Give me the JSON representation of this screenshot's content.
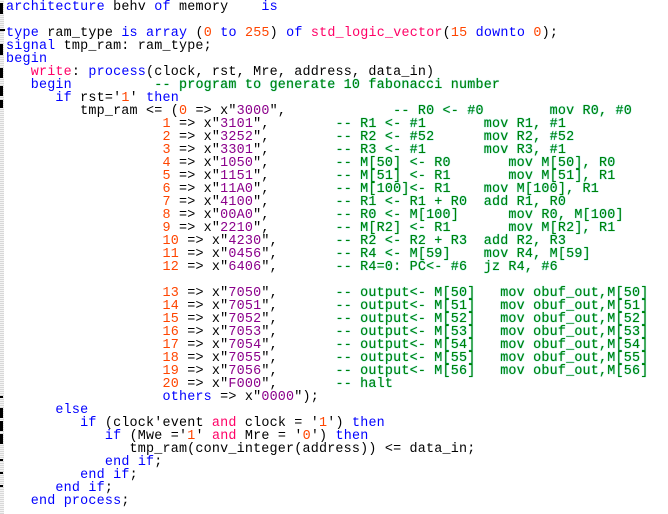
{
  "colors": {
    "keyword": "#0000ff",
    "type_function": "#ff0066",
    "number": "#ff4500",
    "string": "#8b008b",
    "comment": "#008000",
    "plain": "#000000"
  },
  "lines": [
    [
      [
        "kw",
        "architecture"
      ],
      [
        "id",
        " behv "
      ],
      [
        "kw",
        "of"
      ],
      [
        "id",
        " memory    "
      ],
      [
        "kw",
        "is"
      ]
    ],
    [],
    [
      [
        "kw",
        "type"
      ],
      [
        "id",
        " ram_type "
      ],
      [
        "kw",
        "is"
      ],
      [
        "id",
        " "
      ],
      [
        "kw",
        "array"
      ],
      [
        "id",
        " ("
      ],
      [
        "num",
        "0"
      ],
      [
        "id",
        " "
      ],
      [
        "kw",
        "to"
      ],
      [
        "id",
        " "
      ],
      [
        "num",
        "255"
      ],
      [
        "id",
        ") "
      ],
      [
        "kw",
        "of"
      ],
      [
        "id",
        " "
      ],
      [
        "fn",
        "std_logic_vector"
      ],
      [
        "id",
        "("
      ],
      [
        "num",
        "15"
      ],
      [
        "id",
        " "
      ],
      [
        "kw",
        "downto"
      ],
      [
        "id",
        " "
      ],
      [
        "num",
        "0"
      ],
      [
        "id",
        ");"
      ]
    ],
    [
      [
        "kw",
        "signal"
      ],
      [
        "id",
        " tmp_ram: ram_type;"
      ]
    ],
    [
      [
        "kw",
        "begin"
      ]
    ],
    [
      [
        "id",
        "   "
      ],
      [
        "fn",
        "write"
      ],
      [
        "id",
        ": "
      ],
      [
        "kw",
        "process"
      ],
      [
        "id",
        "(clock, rst, Mre, address, data_in)"
      ]
    ],
    [
      [
        "id",
        "   "
      ],
      [
        "kw",
        "begin"
      ],
      [
        "cm",
        "          -- program to generate 10 fabonacci number"
      ]
    ],
    [
      [
        "id",
        "      "
      ],
      [
        "kw",
        "if"
      ],
      [
        "id",
        " rst='"
      ],
      [
        "num",
        "1"
      ],
      [
        "id",
        "' "
      ],
      [
        "kw",
        "then"
      ]
    ],
    [
      [
        "id",
        "         tmp_ram <= ("
      ],
      [
        "num",
        "0"
      ],
      [
        "id",
        " => x\""
      ],
      [
        "str",
        "3000"
      ],
      [
        "id",
        "\","
      ],
      [
        "cm",
        "             -- R0 <- #0        mov R0, #0"
      ]
    ],
    [
      [
        "id",
        "                   "
      ],
      [
        "num",
        "1"
      ],
      [
        "id",
        " => x\""
      ],
      [
        "str",
        "3101"
      ],
      [
        "id",
        "\","
      ],
      [
        "cm",
        "        -- R1 <- #1       mov R1, #1"
      ]
    ],
    [
      [
        "id",
        "                   "
      ],
      [
        "num",
        "2"
      ],
      [
        "id",
        " => x\""
      ],
      [
        "str",
        "3252"
      ],
      [
        "id",
        "\","
      ],
      [
        "cm",
        "        -- R2 <- #52      mov R2, #52"
      ]
    ],
    [
      [
        "id",
        "                   "
      ],
      [
        "num",
        "3"
      ],
      [
        "id",
        " => x\""
      ],
      [
        "str",
        "3301"
      ],
      [
        "id",
        "\","
      ],
      [
        "cm",
        "        -- R3 <- #1       mov R3, #1"
      ]
    ],
    [
      [
        "id",
        "                   "
      ],
      [
        "num",
        "4"
      ],
      [
        "id",
        " => x\""
      ],
      [
        "str",
        "1050"
      ],
      [
        "id",
        "\","
      ],
      [
        "cm",
        "        -- M[50] <- R0       mov M[50], R0"
      ]
    ],
    [
      [
        "id",
        "                   "
      ],
      [
        "num",
        "5"
      ],
      [
        "id",
        " => x\""
      ],
      [
        "str",
        "1151"
      ],
      [
        "id",
        "\","
      ],
      [
        "cm",
        "        -- M[51] <- R1       mov M[51], R1"
      ]
    ],
    [
      [
        "id",
        "                   "
      ],
      [
        "num",
        "6"
      ],
      [
        "id",
        " => x\""
      ],
      [
        "str",
        "11A0"
      ],
      [
        "id",
        "\","
      ],
      [
        "cm",
        "        -- M[100]<- R1    mov M[100], R1"
      ]
    ],
    [
      [
        "id",
        "                   "
      ],
      [
        "num",
        "7"
      ],
      [
        "id",
        " => x\""
      ],
      [
        "str",
        "4100"
      ],
      [
        "id",
        "\","
      ],
      [
        "cm",
        "        -- R1 <- R1 + R0  add R1, R0"
      ]
    ],
    [
      [
        "id",
        "                   "
      ],
      [
        "num",
        "8"
      ],
      [
        "id",
        " => x\""
      ],
      [
        "str",
        "00A0"
      ],
      [
        "id",
        "\","
      ],
      [
        "cm",
        "        -- R0 <- M[100]      mov R0, M[100]"
      ]
    ],
    [
      [
        "id",
        "                   "
      ],
      [
        "num",
        "9"
      ],
      [
        "id",
        " => x\""
      ],
      [
        "str",
        "2210"
      ],
      [
        "id",
        "\","
      ],
      [
        "cm",
        "        -- M[R2] <- R1       mov M[R2], R1"
      ]
    ],
    [
      [
        "id",
        "                   "
      ],
      [
        "num",
        "10"
      ],
      [
        "id",
        " => x\""
      ],
      [
        "str",
        "4230"
      ],
      [
        "id",
        "\","
      ],
      [
        "cm",
        "       -- R2 <- R2 + R3  add R2, R3"
      ]
    ],
    [
      [
        "id",
        "                   "
      ],
      [
        "num",
        "11"
      ],
      [
        "id",
        " => x\""
      ],
      [
        "str",
        "0456"
      ],
      [
        "id",
        "\","
      ],
      [
        "cm",
        "       -- R4 <- M[59]    mov R4, M[59]"
      ]
    ],
    [
      [
        "id",
        "                   "
      ],
      [
        "num",
        "12"
      ],
      [
        "id",
        " => x\""
      ],
      [
        "str",
        "6406"
      ],
      [
        "id",
        "\","
      ],
      [
        "cm",
        "       -- R4=0: PC<- #6  jz R4, #6"
      ]
    ],
    [],
    [
      [
        "id",
        "                   "
      ],
      [
        "num",
        "13"
      ],
      [
        "id",
        " => x\""
      ],
      [
        "str",
        "7050"
      ],
      [
        "id",
        "\","
      ],
      [
        "cm",
        "       -- output<- M[50]   mov obuf_out,M[50]"
      ]
    ],
    [
      [
        "id",
        "                   "
      ],
      [
        "num",
        "14"
      ],
      [
        "id",
        " => x\""
      ],
      [
        "str",
        "7051"
      ],
      [
        "id",
        "\","
      ],
      [
        "cm",
        "       -- output<- M[51]   mov obuf_out,M[51]"
      ]
    ],
    [
      [
        "id",
        "                   "
      ],
      [
        "num",
        "15"
      ],
      [
        "id",
        " => x\""
      ],
      [
        "str",
        "7052"
      ],
      [
        "id",
        "\","
      ],
      [
        "cm",
        "       -- output<- M[52]   mov obuf_out,M[52]"
      ]
    ],
    [
      [
        "id",
        "                   "
      ],
      [
        "num",
        "16"
      ],
      [
        "id",
        " => x\""
      ],
      [
        "str",
        "7053"
      ],
      [
        "id",
        "\","
      ],
      [
        "cm",
        "       -- output<- M[53]   mov obuf_out,M[53]"
      ]
    ],
    [
      [
        "id",
        "                   "
      ],
      [
        "num",
        "17"
      ],
      [
        "id",
        " => x\""
      ],
      [
        "str",
        "7054"
      ],
      [
        "id",
        "\","
      ],
      [
        "cm",
        "       -- output<- M[54]   mov obuf_out,M[54]"
      ]
    ],
    [
      [
        "id",
        "                   "
      ],
      [
        "num",
        "18"
      ],
      [
        "id",
        " => x\""
      ],
      [
        "str",
        "7055"
      ],
      [
        "id",
        "\","
      ],
      [
        "cm",
        "       -- output<- M[55]   mov obuf_out,M[55]"
      ]
    ],
    [
      [
        "id",
        "                   "
      ],
      [
        "num",
        "19"
      ],
      [
        "id",
        " => x\""
      ],
      [
        "str",
        "7056"
      ],
      [
        "id",
        "\","
      ],
      [
        "cm",
        "       -- output<- M[56]   mov obuf_out,M[56]"
      ]
    ],
    [
      [
        "id",
        "                   "
      ],
      [
        "num",
        "20"
      ],
      [
        "id",
        " => x\""
      ],
      [
        "str",
        "F000"
      ],
      [
        "id",
        "\","
      ],
      [
        "cm",
        "       -- halt"
      ]
    ],
    [
      [
        "id",
        "                   "
      ],
      [
        "kw",
        "others"
      ],
      [
        "id",
        " => x\""
      ],
      [
        "str",
        "0000"
      ],
      [
        "id",
        "\");"
      ]
    ],
    [
      [
        "id",
        "      "
      ],
      [
        "kw",
        "else"
      ]
    ],
    [
      [
        "id",
        "         "
      ],
      [
        "kw",
        "if"
      ],
      [
        "id",
        " (clock'event "
      ],
      [
        "fn",
        "and"
      ],
      [
        "id",
        " clock = '"
      ],
      [
        "num",
        "1"
      ],
      [
        "id",
        "') "
      ],
      [
        "kw",
        "then"
      ]
    ],
    [
      [
        "id",
        "            "
      ],
      [
        "kw",
        "if"
      ],
      [
        "id",
        " (Mwe ='"
      ],
      [
        "num",
        "1"
      ],
      [
        "id",
        "' "
      ],
      [
        "fn",
        "and"
      ],
      [
        "id",
        " Mre = '"
      ],
      [
        "num",
        "0"
      ],
      [
        "id",
        "') "
      ],
      [
        "kw",
        "then"
      ]
    ],
    [
      [
        "id",
        "               tmp_ram(conv_integer(address)) <= data_in;"
      ]
    ],
    [
      [
        "id",
        "            "
      ],
      [
        "kw",
        "end"
      ],
      [
        "id",
        " "
      ],
      [
        "kw",
        "if"
      ],
      [
        "id",
        ";"
      ]
    ],
    [
      [
        "id",
        "         "
      ],
      [
        "kw",
        "end"
      ],
      [
        "id",
        " "
      ],
      [
        "kw",
        "if"
      ],
      [
        "id",
        ";"
      ]
    ],
    [
      [
        "id",
        "      "
      ],
      [
        "kw",
        "end"
      ],
      [
        "id",
        " "
      ],
      [
        "kw",
        "if"
      ],
      [
        "id",
        ";"
      ]
    ],
    [
      [
        "id",
        "   "
      ],
      [
        "kw",
        "end"
      ],
      [
        "id",
        " "
      ],
      [
        "kw",
        "process"
      ],
      [
        "id",
        ";"
      ]
    ]
  ]
}
